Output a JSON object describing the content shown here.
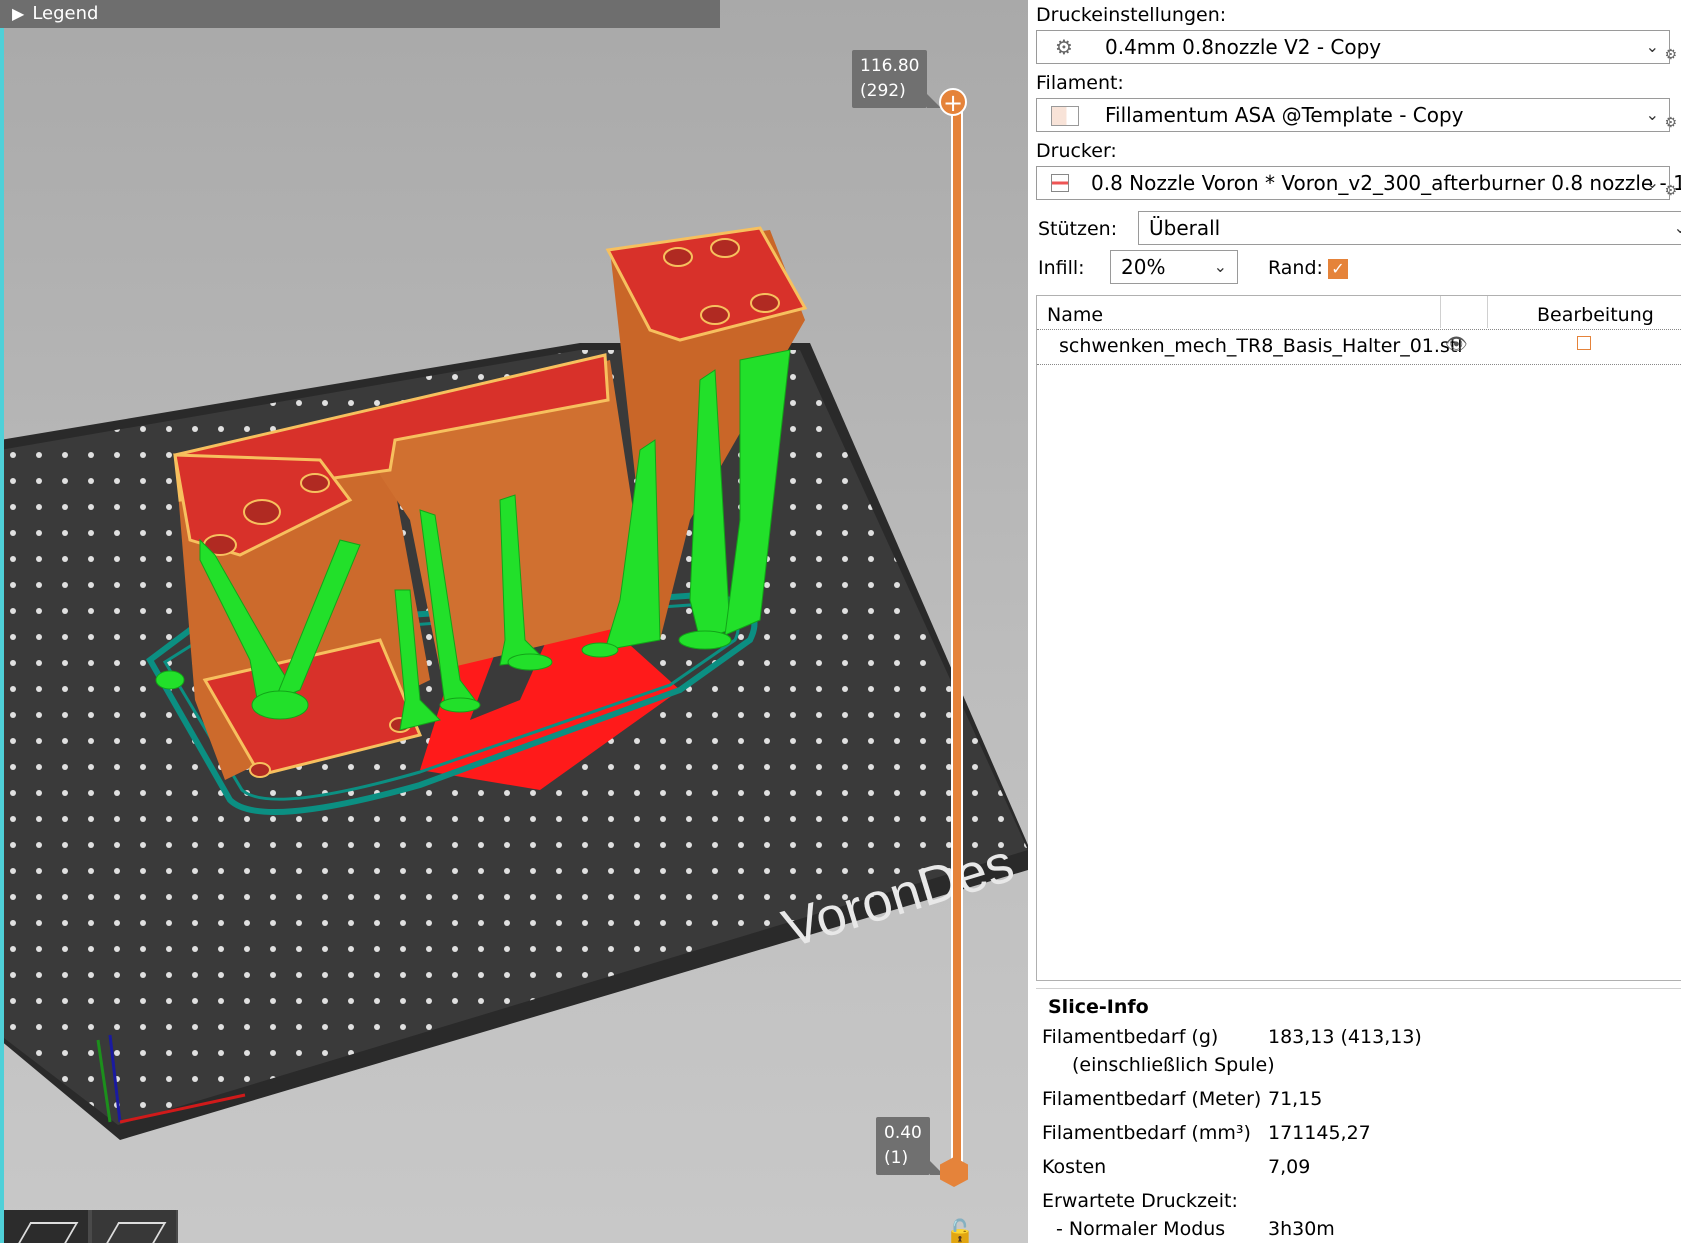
{
  "viewport": {
    "legend_label": "Legend",
    "top_value": "116.80",
    "top_layer": "(292)",
    "bottom_value": "0.40",
    "bottom_layer": "(1)",
    "bed_text": "VoronDes",
    "icons": [
      "play-triangle-icon",
      "plus-icon",
      "lock-icon",
      "view-iso-icon",
      "view-top-icon"
    ]
  },
  "panel": {
    "print_settings_label": "Druckeinstellungen:",
    "print_settings_value": "0.4mm 0.8nozzle V2 - Copy",
    "filament_label": "Filament:",
    "filament_value": "Fillamentum ASA @Template - Copy",
    "printer_label": "Drucker:",
    "printer_value": "0.8 Nozzle Voron  * Voron_v2_300_afterburner 0.8 nozzle - 1. ...",
    "supports_label": "Stützen:",
    "supports_value": "Überall",
    "infill_label": "Infill:",
    "infill_value": "20%",
    "brim_label": "Rand:",
    "brim_checked": true,
    "table": {
      "col_name": "Name",
      "col_edit": "Bearbeitung",
      "rows": [
        {
          "name": "schwenken_mech_TR8_Basis_Halter_01.stl"
        }
      ]
    },
    "slice_info": {
      "title": "Slice-Info",
      "filament_g_label": "Filamentbedarf (g)",
      "filament_g_sub": "(einschließlich Spule)",
      "filament_g_value": "183,13 (413,13)",
      "filament_m_label": "Filamentbedarf (Meter)",
      "filament_m_value": "71,15",
      "filament_mm3_label": "Filamentbedarf (mm³)",
      "filament_mm3_value": "171145,27",
      "cost_label": "Kosten",
      "cost_value": "7,09",
      "time_label": "Erwartete Druckzeit:",
      "normal_mode_label": "- Normaler Modus",
      "normal_mode_value": "3h30m"
    }
  }
}
